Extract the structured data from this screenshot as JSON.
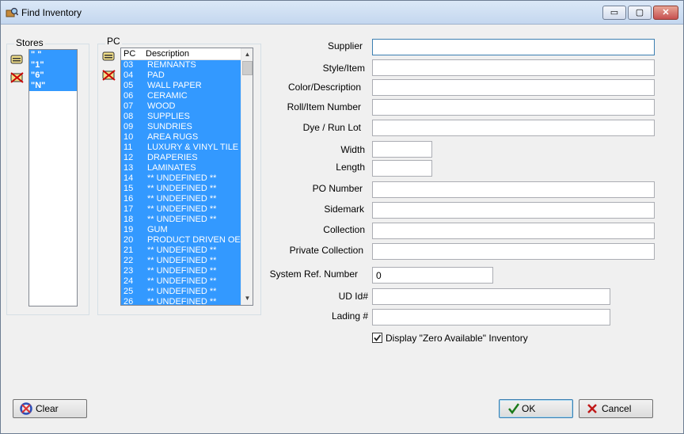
{
  "window": {
    "title": "Find Inventory",
    "minimize": "▭",
    "maximize": "▢",
    "close": "✕"
  },
  "stores": {
    "label": "Stores",
    "items": [
      "\" \"",
      "\"1\"",
      "\"6\"",
      "\"N\""
    ]
  },
  "pc": {
    "label": "PC",
    "columns": [
      "PC",
      "Description"
    ],
    "rows": [
      [
        "03",
        "REMNANTS"
      ],
      [
        "04",
        "PAD"
      ],
      [
        "05",
        "WALL PAPER"
      ],
      [
        "06",
        "CERAMIC"
      ],
      [
        "07",
        "WOOD"
      ],
      [
        "08",
        "SUPPLIES"
      ],
      [
        "09",
        "SUNDRIES"
      ],
      [
        "10",
        "AREA RUGS"
      ],
      [
        "11",
        "LUXURY & VINYL TILE"
      ],
      [
        "12",
        "DRAPERIES"
      ],
      [
        "13",
        "LAMINATES"
      ],
      [
        "14",
        "** UNDEFINED **"
      ],
      [
        "15",
        "** UNDEFINED **"
      ],
      [
        "16",
        "** UNDEFINED **"
      ],
      [
        "17",
        "** UNDEFINED **"
      ],
      [
        "18",
        "** UNDEFINED **"
      ],
      [
        "19",
        "GUM"
      ],
      [
        "20",
        "PRODUCT DRIVEN OE"
      ],
      [
        "21",
        "** UNDEFINED **"
      ],
      [
        "22",
        "** UNDEFINED **"
      ],
      [
        "23",
        "** UNDEFINED **"
      ],
      [
        "24",
        "** UNDEFINED **"
      ],
      [
        "25",
        "** UNDEFINED **"
      ],
      [
        "26",
        "** UNDEFINED **"
      ]
    ]
  },
  "fields": {
    "supplier": {
      "label": "Supplier",
      "value": ""
    },
    "style_item": {
      "label": "Style/Item",
      "value": ""
    },
    "color_description": {
      "label": "Color/Description",
      "value": ""
    },
    "roll_item_number": {
      "label": "Roll/Item Number",
      "value": ""
    },
    "dye_run_lot": {
      "label": "Dye / Run Lot",
      "value": ""
    },
    "width": {
      "label": "Width",
      "value": ""
    },
    "length": {
      "label": "Length",
      "value": ""
    },
    "po_number": {
      "label": "PO Number",
      "value": ""
    },
    "sidemark": {
      "label": "Sidemark",
      "value": ""
    },
    "collection": {
      "label": "Collection",
      "value": ""
    },
    "private_collection": {
      "label": "Private Collection",
      "value": ""
    },
    "system_ref_number": {
      "label": "System Ref. Number",
      "value": "0"
    },
    "ud_id": {
      "label": "UD Id#",
      "value": ""
    },
    "lading": {
      "label": "Lading #",
      "value": ""
    }
  },
  "zero_available": {
    "label": "Display \"Zero Available\" Inventory",
    "checked": true
  },
  "buttons": {
    "clear": "Clear",
    "ok": "OK",
    "cancel": "Cancel"
  },
  "icons": {
    "title": "find-inventory-icon",
    "select_all": "select-all-icon",
    "deselect": "deselect-icon",
    "clear": "clear-icon",
    "ok": "checkmark-icon",
    "cancel": "x-icon"
  },
  "colors": {
    "selection": "#3399ff",
    "titlebar": "#c4d7ef"
  }
}
